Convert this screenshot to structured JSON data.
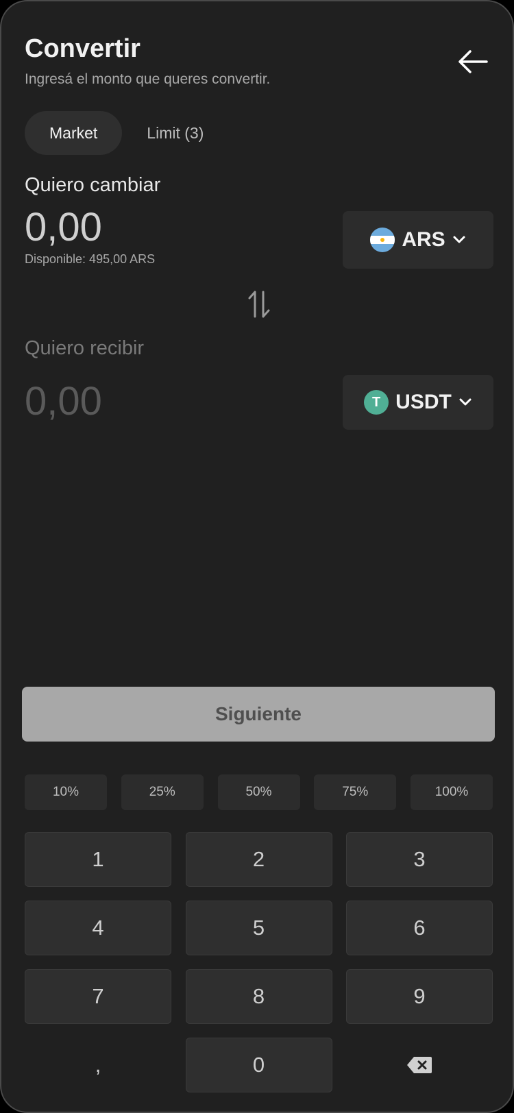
{
  "header": {
    "title": "Convertir",
    "subtitle": "Ingresá el monto que queres convertir."
  },
  "tabs": [
    {
      "label": "Market",
      "active": true
    },
    {
      "label": "Limit (3)",
      "active": false
    }
  ],
  "send": {
    "label": "Quiero cambiar",
    "amount": "0,00",
    "available": "Disponible: 495,00 ARS",
    "currency": "ARS"
  },
  "receive": {
    "label": "Quiero recibir",
    "amount": "0,00",
    "currency": "USDT",
    "currency_icon_letter": "T"
  },
  "next_button": "Siguiente",
  "percent_buttons": [
    "10%",
    "25%",
    "50%",
    "75%",
    "100%"
  ],
  "keypad": [
    "1",
    "2",
    "3",
    "4",
    "5",
    "6",
    "7",
    "8",
    "9",
    ",",
    "0"
  ],
  "icons": {
    "back": "arrow-left-icon",
    "chevron": "chevron-down-icon",
    "swap": "swap-vertical-icon",
    "backspace": "backspace-icon",
    "ars_flag": "argentina-flag-icon",
    "usdt": "tether-icon"
  },
  "colors": {
    "background": "#202020",
    "surface": "#2c2c2c",
    "button_disabled": "#a8a8a8",
    "tether_green": "#50af95",
    "flag_blue": "#6cabdd"
  }
}
